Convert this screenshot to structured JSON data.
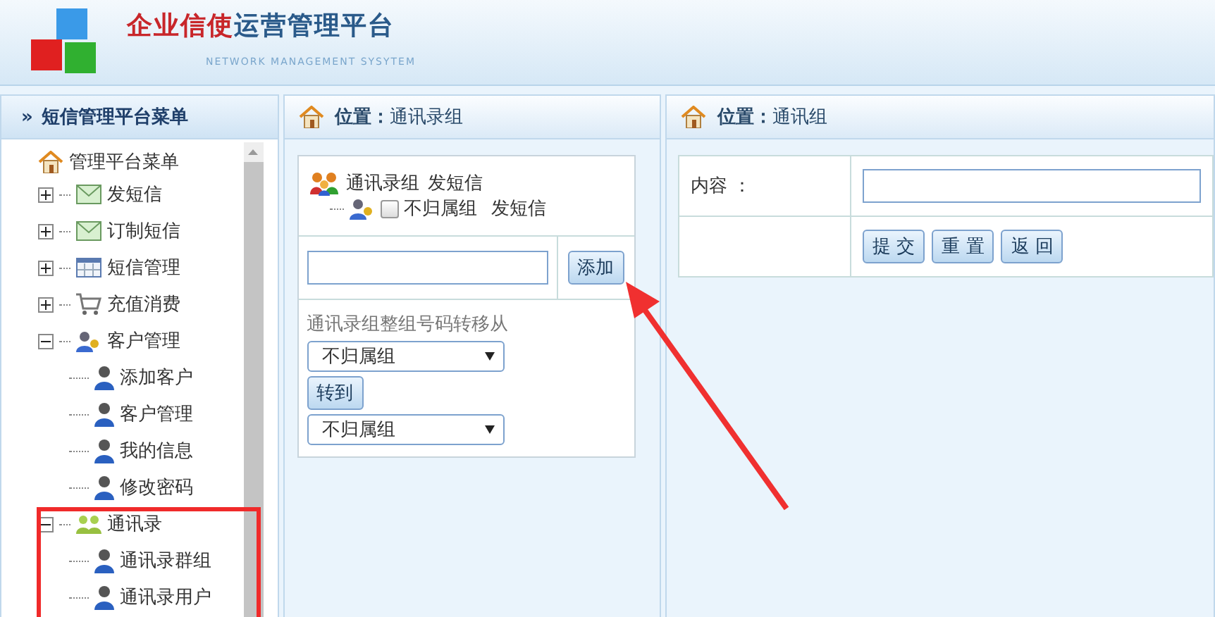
{
  "header": {
    "title_accent": "企业信使",
    "title_rest": "运营管理平台",
    "subtitle": "NETWORK MANAGEMENT SYSYTEM"
  },
  "sidebar": {
    "marker": "»",
    "title": "短信管理平台菜单",
    "tree": {
      "label": "管理平台菜单",
      "children": [
        {
          "label": "发短信",
          "kind": "mail",
          "expanded": false
        },
        {
          "label": "订制短信",
          "kind": "mail",
          "expanded": false
        },
        {
          "label": "短信管理",
          "kind": "table",
          "expanded": false
        },
        {
          "label": "充值消费",
          "kind": "cart",
          "expanded": false
        },
        {
          "label": "客户管理",
          "kind": "users",
          "expanded": true,
          "children": [
            {
              "label": "添加客户",
              "kind": "person"
            },
            {
              "label": "客户管理",
              "kind": "person"
            },
            {
              "label": "我的信息",
              "kind": "person"
            },
            {
              "label": "修改密码",
              "kind": "person"
            }
          ]
        },
        {
          "label": "通讯录",
          "kind": "group",
          "expanded": true,
          "children": [
            {
              "label": "通讯录群组",
              "kind": "person"
            },
            {
              "label": "通讯录用户",
              "kind": "person"
            }
          ]
        }
      ]
    }
  },
  "middle": {
    "location_label": "位置：",
    "location": "通讯录组",
    "group": {
      "label": "通讯录组",
      "action": "发短信",
      "children": [
        {
          "label": "不归属组",
          "action": "发短信",
          "checked": false
        }
      ]
    },
    "add_button": "添加",
    "transfer_label": "通讯录组整组号码转移从",
    "from_select": "不归属组",
    "move_button": "转到",
    "to_select": "不归属组"
  },
  "right": {
    "location_label": "位置：",
    "location": "通讯组",
    "content_label": "内容 ：",
    "buttons": [
      "提 交",
      "重 置",
      "返 回"
    ]
  }
}
